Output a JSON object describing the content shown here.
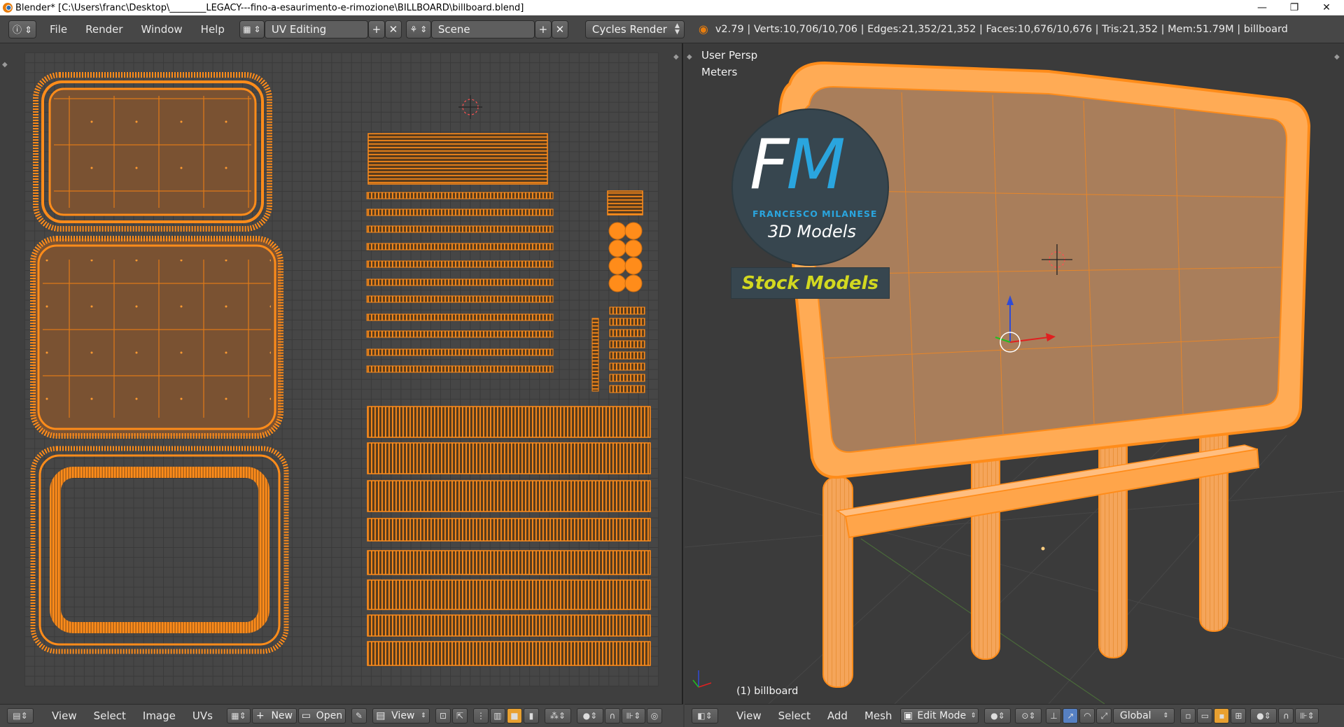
{
  "window": {
    "title": "Blender* [C:\\Users\\franc\\Desktop\\________LEGACY---fino-a-esaurimento-e-rimozione\\BILLBOARD\\billboard.blend]",
    "controls": [
      "—",
      "❐",
      "✕"
    ]
  },
  "info_header": {
    "menus": [
      "File",
      "Render",
      "Window",
      "Help"
    ],
    "screen_layout": "UV Editing",
    "scene": "Scene",
    "render_engine": "Cycles Render",
    "stats": "v2.79 | Verts:10,706/10,706 | Edges:21,352/21,352 | Faces:10,676/10,676 | Tris:21,352 | Mem:51.79M | billboard"
  },
  "viewport": {
    "view_name": "User Persp",
    "units": "Meters",
    "object_label": "(1) billboard",
    "watermark": {
      "initial_f": "F",
      "initial_m": "M",
      "name": "FRANCESCO MILANESE",
      "subtitle": "3D Models",
      "banner": "Stock Models"
    }
  },
  "uv_footer": {
    "menus": [
      "View",
      "Select",
      "Image",
      "UVs"
    ],
    "new_label": "New",
    "open_label": "Open",
    "view_label": "View"
  },
  "view3d_footer": {
    "menus": [
      "View",
      "Select",
      "Add",
      "Mesh"
    ],
    "mode": "Edit Mode",
    "orientation": "Global"
  },
  "colors": {
    "accent": "#ff8c1a",
    "panel": "#474747",
    "uv_face": "#8b5a2b"
  }
}
